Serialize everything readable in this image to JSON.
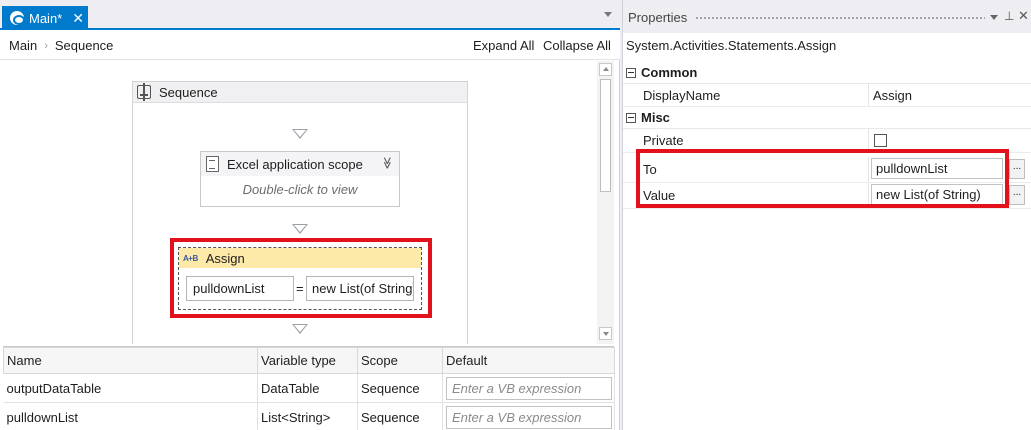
{
  "designer": {
    "tab_label": "Main*",
    "tab_close": "✕",
    "breadcrumb": [
      "Main",
      "Sequence"
    ],
    "breadcrumb_separator": "›",
    "expand_all": "Expand All",
    "collapse_all": "Collapse All"
  },
  "workflow": {
    "sequence_title": "Sequence",
    "excel_scope": {
      "title": "Excel application scope",
      "hint": "Double-click to view",
      "collapse_glyph": "≫"
    },
    "assign": {
      "title": "Assign",
      "icon_text": "A+B",
      "to_value": "pulldownList",
      "equals": "=",
      "value_value": "new List(of String)"
    },
    "highlight_color": "#e3111c"
  },
  "variables": {
    "headers": [
      "Name",
      "Variable type",
      "Scope",
      "Default"
    ],
    "rows": [
      {
        "name": "outputDataTable",
        "type": "DataTable",
        "scope": "Sequence",
        "default_placeholder": "Enter a VB expression"
      },
      {
        "name": "pulldownList",
        "type": "List<String>",
        "scope": "Sequence",
        "default_placeholder": "Enter a VB expression"
      }
    ]
  },
  "properties": {
    "title": "Properties",
    "selected_type": "System.Activities.Statements.Assign",
    "pin_glyph": "⊥",
    "close_glyph": "✕",
    "categories": [
      {
        "name": "Common",
        "rows": [
          {
            "name": "DisplayName",
            "value": "Assign"
          }
        ]
      },
      {
        "name": "Misc",
        "rows": [
          {
            "name": "Private",
            "checked": false
          },
          {
            "name": "To",
            "value": "pulldownList",
            "ellipsis": "..."
          },
          {
            "name": "Value",
            "value": "new List(of String)",
            "ellipsis": "..."
          }
        ]
      }
    ]
  }
}
